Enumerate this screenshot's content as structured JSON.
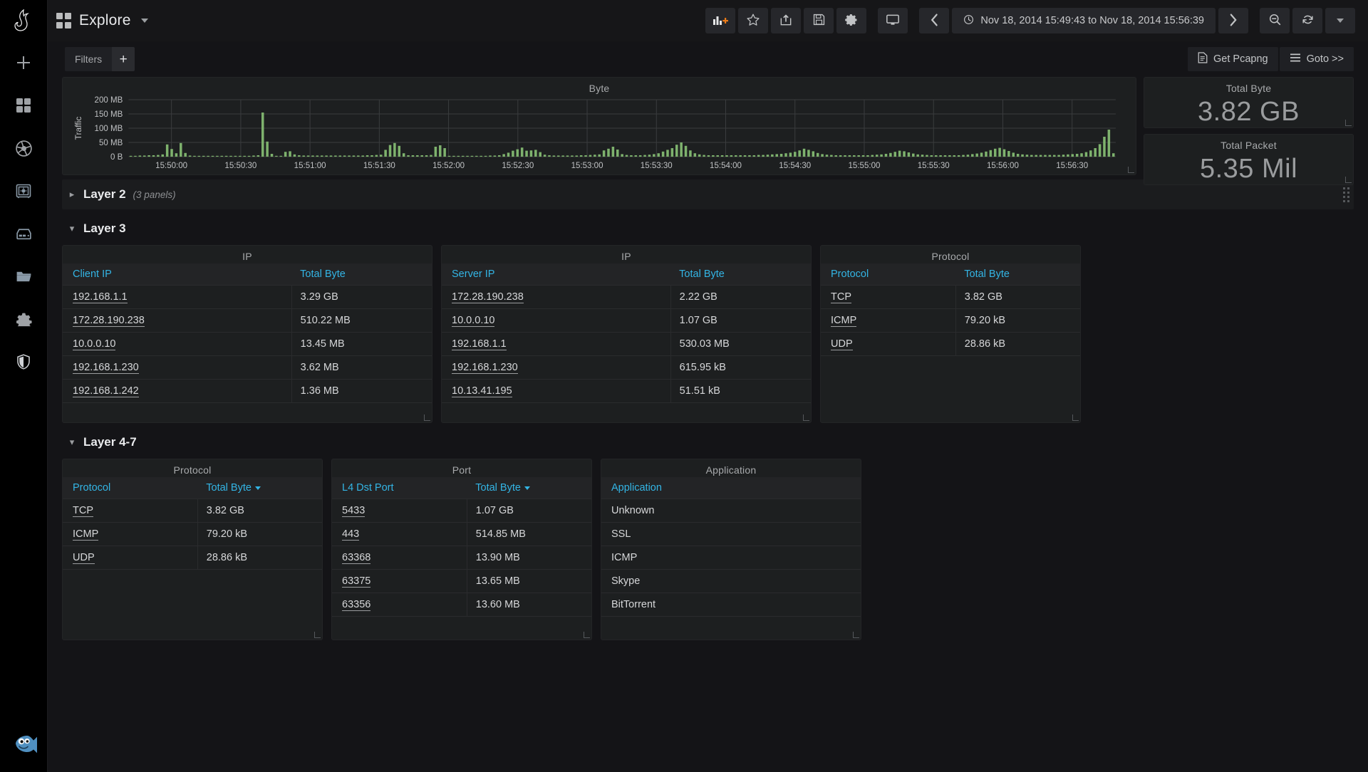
{
  "app": {
    "brand_icon": "grafana-logo-icon",
    "mascot_icon": "blue-fish-mascot-icon"
  },
  "sidebar": {
    "items": [
      {
        "icon": "plus-icon",
        "name": "create-new"
      },
      {
        "icon": "dashboards-grid-icon",
        "name": "dashboards"
      },
      {
        "icon": "aperture-icon",
        "name": "explore"
      },
      {
        "icon": "safe-vault-icon",
        "name": "vault"
      },
      {
        "icon": "server-icon",
        "name": "servers"
      },
      {
        "icon": "folder-icon",
        "name": "folders"
      },
      {
        "icon": "gear-icon",
        "name": "settings"
      },
      {
        "icon": "shield-icon",
        "name": "security"
      }
    ]
  },
  "topbar": {
    "menu_icon": "dashboards-grid-icon",
    "title": "Explore",
    "dropdown_icon": "chevron-down-icon",
    "actions": [
      {
        "name": "add-panel-button",
        "icon": "add-panel-icon"
      },
      {
        "name": "star-button",
        "icon": "star-icon"
      },
      {
        "name": "share-button",
        "icon": "share-icon"
      },
      {
        "name": "save-button",
        "icon": "floppy-save-icon"
      },
      {
        "name": "settings-button",
        "icon": "gear-icon"
      },
      {
        "name": "tv-mode-button",
        "icon": "monitor-icon"
      }
    ],
    "time_prev_icon": "chevron-left-icon",
    "time_next_icon": "chevron-right-icon",
    "time_clock_icon": "clock-icon",
    "time_range": "Nov 18, 2014 15:49:43 to Nov 18, 2014 15:56:39",
    "zoom_out_icon": "zoom-out-icon",
    "refresh_icon": "refresh-icon",
    "refresh_caret_icon": "chevron-down-icon"
  },
  "filterbar": {
    "label": "Filters",
    "add_label": "+",
    "get_pcapng": {
      "label": "Get Pcapng",
      "icon": "document-icon"
    },
    "goto": {
      "label": "Goto >>",
      "icon": "hamburger-icon"
    }
  },
  "stats": [
    {
      "title": "Total Byte",
      "value": "3.82 GB"
    },
    {
      "title": "Total Packet",
      "value": "5.35 Mil"
    }
  ],
  "sections": [
    {
      "title": "Layer 2",
      "sub": "(3 panels)",
      "collapsed": true
    },
    {
      "title": "Layer 3",
      "sub": "",
      "collapsed": false
    },
    {
      "title": "Layer 4-7",
      "sub": "",
      "collapsed": false
    }
  ],
  "layer3": {
    "client_ip": {
      "panel_title": "IP",
      "columns": [
        "Client IP",
        "Total Byte"
      ],
      "rows": [
        [
          "192.168.1.1",
          "3.29 GB"
        ],
        [
          "172.28.190.238",
          "510.22 MB"
        ],
        [
          "10.0.0.10",
          "13.45 MB"
        ],
        [
          "192.168.1.230",
          "3.62 MB"
        ],
        [
          "192.168.1.242",
          "1.36 MB"
        ]
      ]
    },
    "server_ip": {
      "panel_title": "IP",
      "columns": [
        "Server IP",
        "Total Byte"
      ],
      "rows": [
        [
          "172.28.190.238",
          "2.22 GB"
        ],
        [
          "10.0.0.10",
          "1.07 GB"
        ],
        [
          "192.168.1.1",
          "530.03 MB"
        ],
        [
          "192.168.1.230",
          "615.95 kB"
        ],
        [
          "10.13.41.195",
          "51.51 kB"
        ]
      ]
    },
    "protocol": {
      "panel_title": "Protocol",
      "columns": [
        "Protocol",
        "Total Byte"
      ],
      "rows": [
        [
          "TCP",
          "3.82 GB"
        ],
        [
          "ICMP",
          "79.20 kB"
        ],
        [
          "UDP",
          "28.86 kB"
        ]
      ]
    }
  },
  "layer47": {
    "protocol": {
      "panel_title": "Protocol",
      "columns": [
        "Protocol",
        "Total Byte"
      ],
      "sorted_column": "Total Byte",
      "sort_direction": "desc",
      "rows": [
        [
          "TCP",
          "3.82 GB"
        ],
        [
          "ICMP",
          "79.20 kB"
        ],
        [
          "UDP",
          "28.86 kB"
        ]
      ]
    },
    "port": {
      "panel_title": "Port",
      "columns": [
        "L4 Dst Port",
        "Total Byte"
      ],
      "sorted_column": "Total Byte",
      "sort_direction": "desc",
      "rows": [
        [
          "5433",
          "1.07 GB"
        ],
        [
          "443",
          "514.85 MB"
        ],
        [
          "63368",
          "13.90 MB"
        ],
        [
          "63375",
          "13.65 MB"
        ],
        [
          "63356",
          "13.60 MB"
        ]
      ]
    },
    "application": {
      "panel_title": "Application",
      "columns": [
        "Application"
      ],
      "rows": [
        [
          "Unknown"
        ],
        [
          "SSL"
        ],
        [
          "ICMP"
        ],
        [
          "Skype"
        ],
        [
          "BitTorrent"
        ]
      ]
    }
  },
  "chart_data": {
    "type": "bar",
    "title": "Byte",
    "xlabel": "",
    "ylabel": "Traffic",
    "ytick_labels": [
      "0 B",
      "50 MB",
      "100 MB",
      "150 MB",
      "200 MB"
    ],
    "ylim": [
      0,
      200
    ],
    "yunit": "MB",
    "grid": true,
    "legend": "none",
    "bar_color": "#7eb26d",
    "xtick_labels": [
      "15:50:00",
      "15:50:30",
      "15:51:00",
      "15:51:30",
      "15:52:00",
      "15:52:30",
      "15:53:00",
      "15:53:30",
      "15:54:00",
      "15:54:30",
      "15:55:00",
      "15:55:30",
      "15:56:00",
      "15:56:30"
    ],
    "x_start": "15:49:43",
    "x_end": "15:56:39",
    "values": [
      2,
      3,
      4,
      4,
      5,
      5,
      6,
      8,
      43,
      27,
      12,
      48,
      13,
      4,
      3,
      3,
      3,
      3,
      3,
      3,
      3,
      3,
      3,
      3,
      3,
      3,
      3,
      4,
      5,
      155,
      53,
      10,
      2,
      2,
      17,
      19,
      8,
      5,
      4,
      4,
      4,
      4,
      4,
      4,
      4,
      4,
      4,
      4,
      4,
      4,
      4,
      4,
      5,
      5,
      6,
      7,
      24,
      41,
      48,
      38,
      12,
      5,
      5,
      5,
      5,
      5,
      6,
      35,
      40,
      30,
      3,
      2,
      2,
      2,
      2,
      3,
      3,
      3,
      3,
      4,
      4,
      5,
      9,
      14,
      21,
      26,
      32,
      21,
      22,
      24,
      16,
      7,
      5,
      4,
      4,
      4,
      4,
      4,
      4,
      5,
      5,
      6,
      7,
      8,
      22,
      28,
      35,
      25,
      9,
      6,
      5,
      5,
      5,
      6,
      7,
      9,
      12,
      18,
      24,
      30,
      42,
      50,
      38,
      22,
      12,
      8,
      6,
      5,
      5,
      5,
      5,
      5,
      5,
      5,
      5,
      5,
      5,
      5,
      6,
      6,
      7,
      8,
      9,
      10,
      12,
      14,
      17,
      22,
      28,
      24,
      19,
      13,
      9,
      7,
      6,
      5,
      5,
      5,
      5,
      5,
      5,
      5,
      5,
      6,
      7,
      8,
      10,
      13,
      17,
      21,
      19,
      15,
      11,
      8,
      7,
      6,
      5,
      5,
      5,
      5,
      5,
      5,
      5,
      6,
      7,
      9,
      11,
      14,
      18,
      23,
      28,
      31,
      26,
      20,
      14,
      10,
      8,
      7,
      6,
      6,
      6,
      6,
      6,
      6,
      6,
      7,
      8,
      9,
      10,
      12,
      16,
      22,
      30,
      44,
      70,
      95,
      12
    ]
  }
}
